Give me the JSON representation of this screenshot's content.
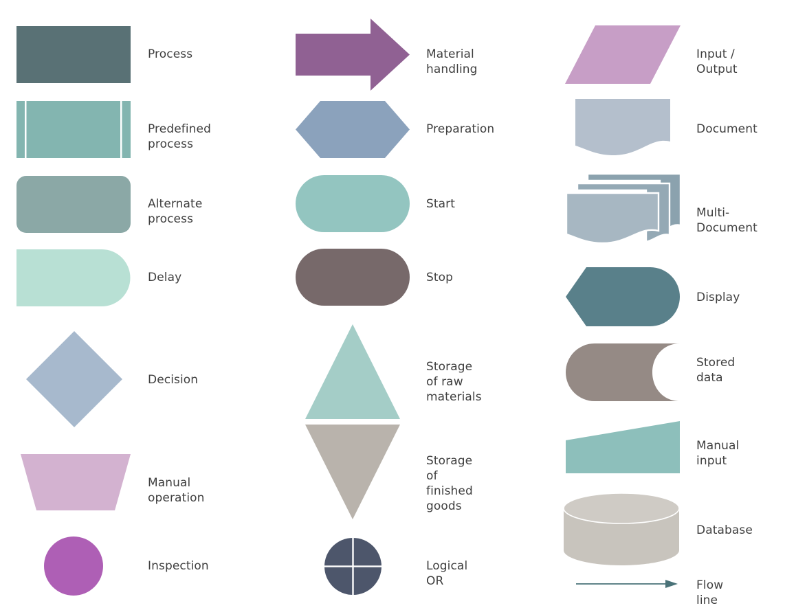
{
  "palette": {
    "process": "#597175",
    "predefined_process": "#83b5b0",
    "alternate_process": "#8ba8a6",
    "delay": "#b8e0d4",
    "decision": "#a7b9cd",
    "manual_operation": "#d3b2d0",
    "inspection": "#ae5fb5",
    "material_handling": "#906193",
    "preparation": "#8ba2bc",
    "start": "#93c5c0",
    "stop": "#77696a",
    "storage_raw": "#a4cdc7",
    "storage_finished": "#b9b3ac",
    "logical_or": "#4d566b",
    "input_output": "#c79ec6",
    "document": "#b4bfcc",
    "multi_document_back": "#8ba2ae",
    "multi_document_mid": "#94a9b5",
    "multi_document_front": "#a7b7c2",
    "display": "#59808a",
    "stored_data": "#958a85",
    "manual_input": "#8dbfbb",
    "database": "#c8c4bd",
    "database_top": "#cfcbc5",
    "flow_line": "#4a7278",
    "label_text": "#3f3f3f",
    "background": "#ffffff",
    "stripe": "#ffffff"
  },
  "columns": [
    {
      "name": "column-one",
      "items": [
        {
          "id": "process",
          "label": "Process",
          "shape": "rectangle"
        },
        {
          "id": "predefined-process",
          "label": "Predefined process",
          "shape": "predefined-process"
        },
        {
          "id": "alternate-process",
          "label": "Alternate process",
          "shape": "rounded-rectangle"
        },
        {
          "id": "delay",
          "label": "Delay",
          "shape": "delay"
        },
        {
          "id": "decision",
          "label": "Decision",
          "shape": "diamond"
        },
        {
          "id": "manual-operation",
          "label": "Manual operation",
          "shape": "trapezoid"
        },
        {
          "id": "inspection",
          "label": "Inspection",
          "shape": "circle"
        }
      ]
    },
    {
      "name": "column-two",
      "items": [
        {
          "id": "material-handling",
          "label": "Material handling",
          "shape": "right-arrow"
        },
        {
          "id": "preparation",
          "label": "Preparation",
          "shape": "hexagon"
        },
        {
          "id": "start",
          "label": "Start",
          "shape": "stadium"
        },
        {
          "id": "stop",
          "label": "Stop",
          "shape": "stadium"
        },
        {
          "id": "storage-of-raw-materials",
          "label": "Storage of raw\nmaterials",
          "shape": "triangle-up"
        },
        {
          "id": "storage-of-finished-goods",
          "label": "Storage of finished\n goods",
          "shape": "triangle-down"
        },
        {
          "id": "logical-or",
          "label": "Logical OR",
          "shape": "circle-cross"
        }
      ]
    },
    {
      "name": "column-three",
      "items": [
        {
          "id": "input-output",
          "label": "Input / Output",
          "shape": "parallelogram"
        },
        {
          "id": "document",
          "label": "Document",
          "shape": "document"
        },
        {
          "id": "multi-document",
          "label": "Multi-Document",
          "shape": "multi-document"
        },
        {
          "id": "display",
          "label": "Display",
          "shape": "display"
        },
        {
          "id": "stored-data",
          "label": "Stored data",
          "shape": "stored-data"
        },
        {
          "id": "manual-input",
          "label": "Manual input",
          "shape": "manual-input"
        },
        {
          "id": "database",
          "label": "Database",
          "shape": "cylinder"
        },
        {
          "id": "flow-line",
          "label": "Flow line",
          "shape": "arrow-line"
        }
      ]
    }
  ]
}
